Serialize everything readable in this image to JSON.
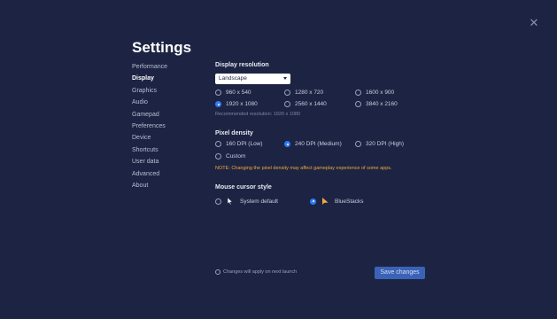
{
  "title": "Settings",
  "close_icon": "close-icon",
  "nav": {
    "items": [
      {
        "label": "Performance"
      },
      {
        "label": "Display",
        "active": true
      },
      {
        "label": "Graphics"
      },
      {
        "label": "Audio"
      },
      {
        "label": "Gamepad"
      },
      {
        "label": "Preferences"
      },
      {
        "label": "Device"
      },
      {
        "label": "Shortcuts"
      },
      {
        "label": "User data"
      },
      {
        "label": "Advanced"
      },
      {
        "label": "About"
      }
    ]
  },
  "display_resolution": {
    "title": "Display resolution",
    "orientation": "Landscape",
    "options": [
      "960 x 540",
      "1280 x 720",
      "1600 x 900",
      "1920 x 1080",
      "2560 x 1440",
      "3840 x 2160"
    ],
    "selected": "1920 x 1080",
    "recommended": "Recommended resolution: 1920 x 1080"
  },
  "pixel_density": {
    "title": "Pixel density",
    "options": [
      "160 DPI (Low)",
      "240 DPI (Medium)",
      "320 DPI (High)",
      "Custom"
    ],
    "selected": "240 DPI (Medium)",
    "note": "NOTE: Changing the pixel density may affect gameplay experience of some apps."
  },
  "mouse_cursor": {
    "title": "Mouse cursor style",
    "options": [
      "System default",
      "BlueStacks"
    ],
    "selected": "BlueStacks"
  },
  "footer": {
    "note": "Changes will apply on next launch",
    "save_label": "Save changes"
  },
  "colors": {
    "background": "#1d2443",
    "accent": "#2f7cf6",
    "note": "#f0a93a",
    "save_button": "#3a63b8"
  }
}
